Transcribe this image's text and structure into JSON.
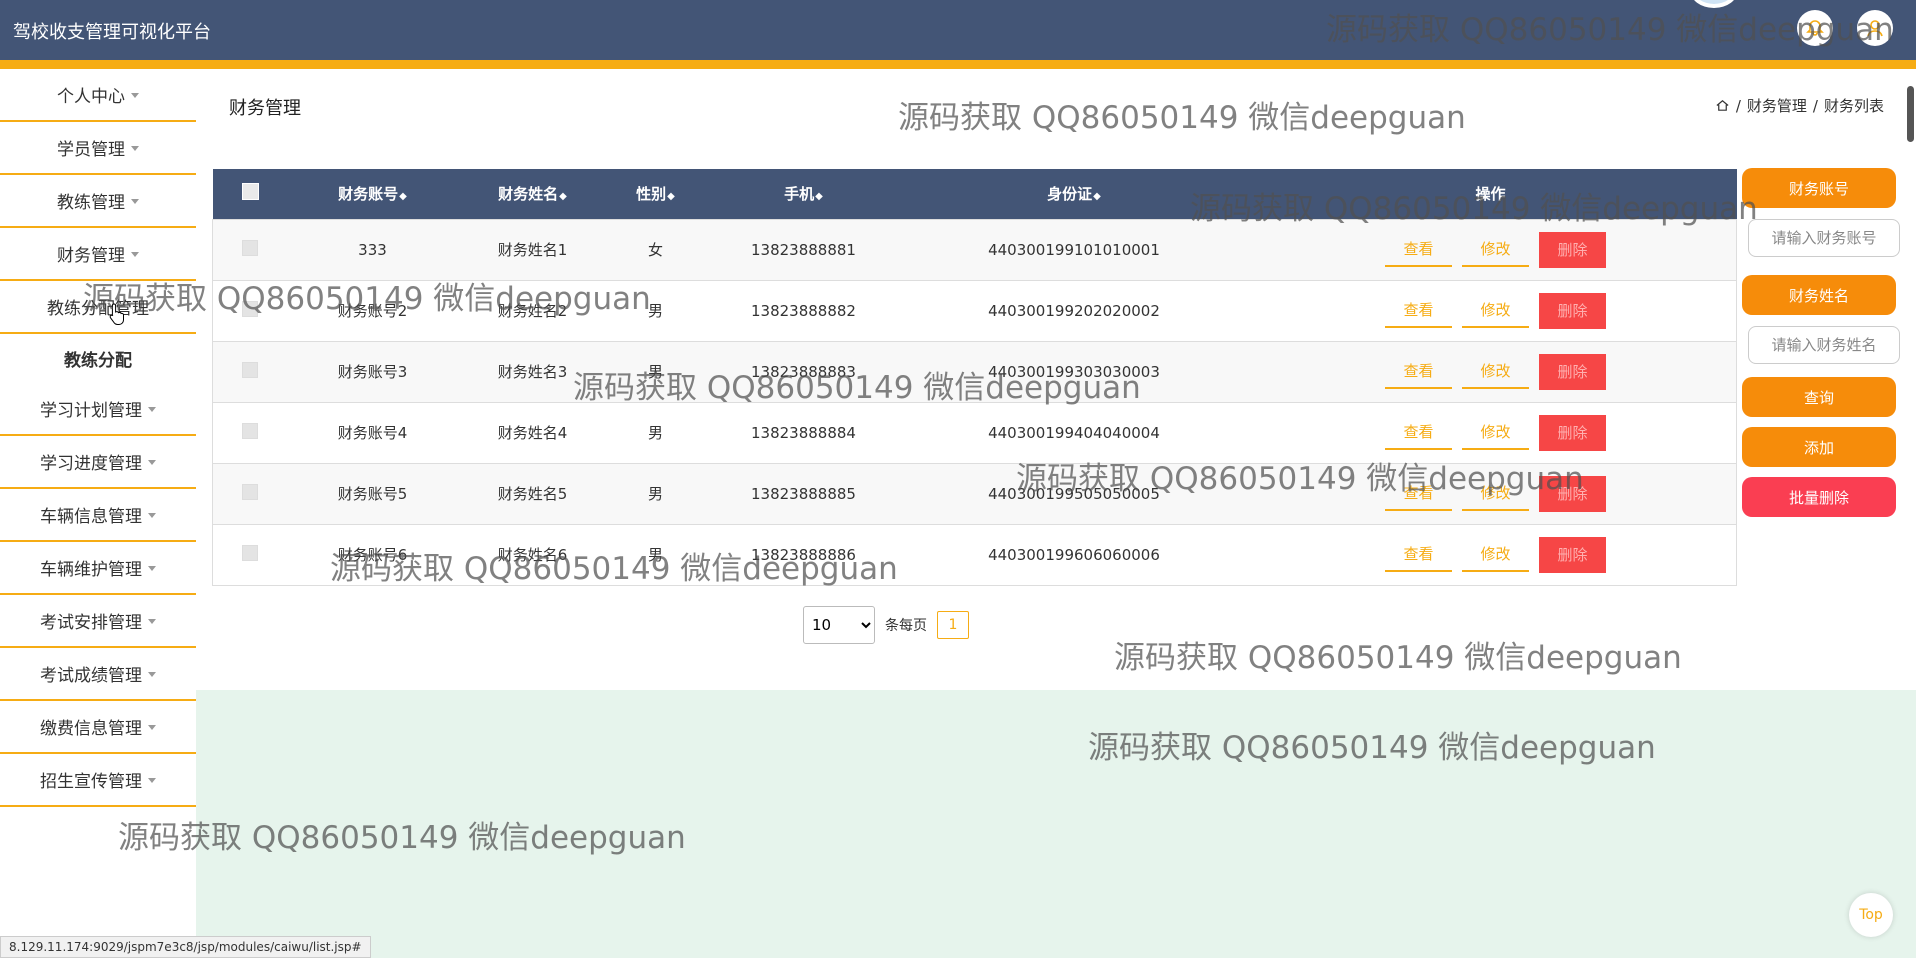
{
  "header": {
    "title": "驾校收支管理可视化平台",
    "accent_color": "#f6ac14",
    "bg_color": "#435576"
  },
  "sidebar": {
    "items": [
      {
        "label": "个人中心"
      },
      {
        "label": "学员管理"
      },
      {
        "label": "教练管理"
      },
      {
        "label": "财务管理"
      },
      {
        "label": "教练分配管理"
      },
      {
        "label": "教练分配",
        "sub": true
      },
      {
        "label": "学习计划管理"
      },
      {
        "label": "学习进度管理"
      },
      {
        "label": "车辆信息管理"
      },
      {
        "label": "车辆维护管理"
      },
      {
        "label": "考试安排管理"
      },
      {
        "label": "考试成绩管理"
      },
      {
        "label": "缴费信息管理"
      },
      {
        "label": "招生宣传管理"
      }
    ]
  },
  "page": {
    "heading": "财务管理",
    "breadcrumb": {
      "sep": "/",
      "level1": "财务管理",
      "level2": "财务列表"
    }
  },
  "table": {
    "headers": {
      "account": "财务账号",
      "name": "财务姓名",
      "gender": "性别",
      "phone": "手机",
      "id_card": "身份证",
      "actions": "操作"
    },
    "rows": [
      {
        "account": "333",
        "name": "财务姓名1",
        "gender": "女",
        "phone": "13823888881",
        "id_card": "440300199101010001"
      },
      {
        "account": "财务账号2",
        "name": "财务姓名2",
        "gender": "男",
        "phone": "13823888882",
        "id_card": "440300199202020002"
      },
      {
        "account": "财务账号3",
        "name": "财务姓名3",
        "gender": "男",
        "phone": "13823888883",
        "id_card": "440300199303030003"
      },
      {
        "account": "财务账号4",
        "name": "财务姓名4",
        "gender": "男",
        "phone": "13823888884",
        "id_card": "440300199404040004"
      },
      {
        "account": "财务账号5",
        "name": "财务姓名5",
        "gender": "男",
        "phone": "13823888885",
        "id_card": "440300199505050005"
      },
      {
        "account": "财务账号6",
        "name": "财务姓名6",
        "gender": "男",
        "phone": "13823888886",
        "id_card": "440300199606060006"
      }
    ],
    "action_labels": {
      "view": "查看",
      "edit": "修改",
      "delete": "删除"
    }
  },
  "pagination": {
    "page_size": "10",
    "per_page_label": "条每页",
    "current_page": "1"
  },
  "right_panel": {
    "account_label": "财务账号",
    "account_placeholder": "请输入财务账号",
    "name_label": "财务姓名",
    "name_placeholder": "请输入财务姓名",
    "search_label": "查询",
    "add_label": "添加",
    "batch_delete_label": "批量删除"
  },
  "top_button": "Top",
  "status_url": "8.129.11.174:9029/jspm7e3c8/jsp/modules/caiwu/list.jsp#",
  "watermark": "源码获取 QQ86050149 微信deepguan"
}
